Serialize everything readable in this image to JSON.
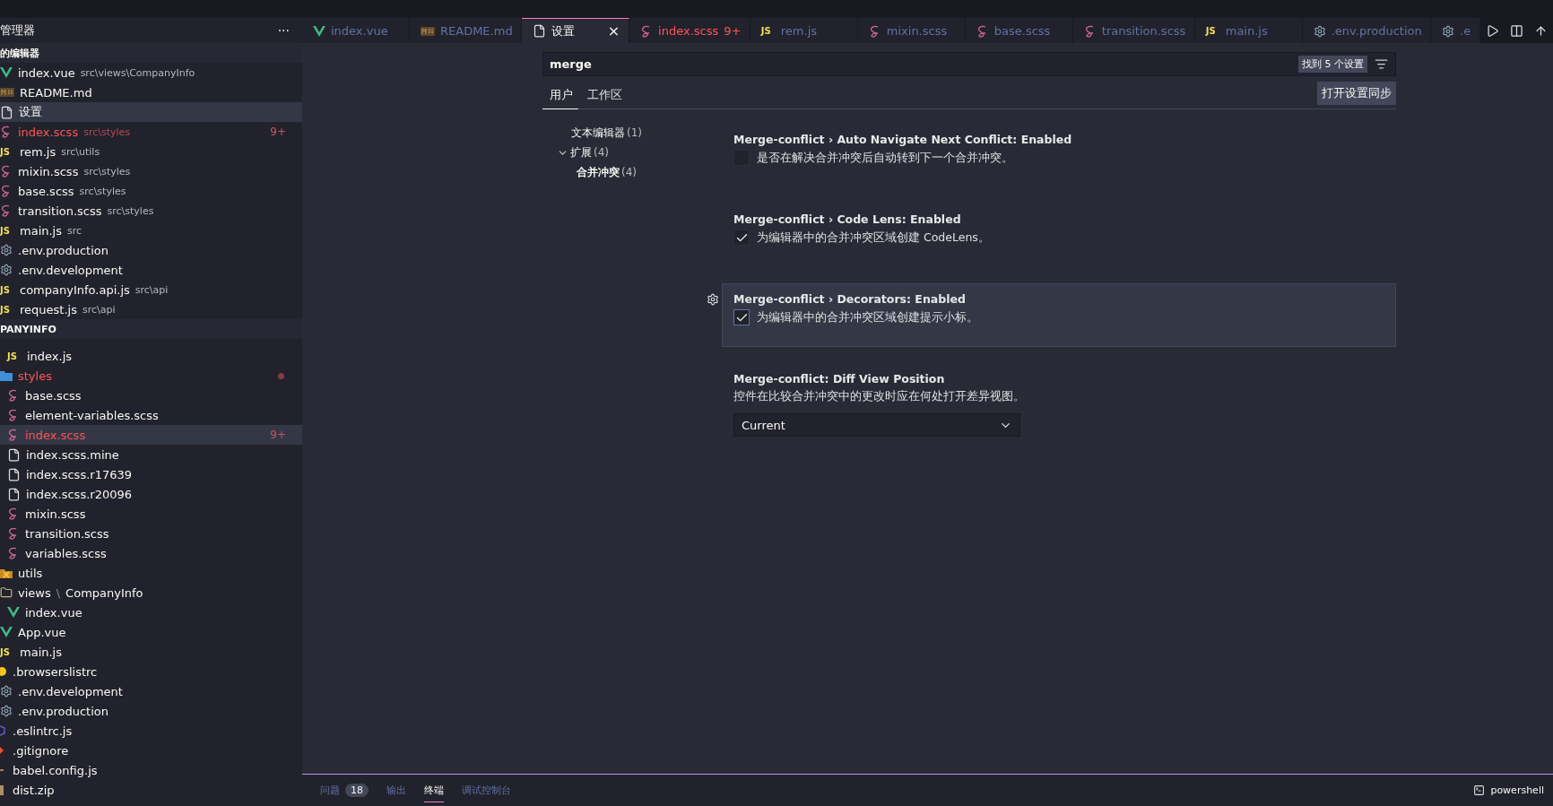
{
  "sidebar": {
    "title": "管理器",
    "more": "···",
    "open_editors": {
      "title": "的编辑器",
      "items": [
        {
          "kind": "vue",
          "name": "index.vue",
          "path": "src\\views\\CompanyInfo",
          "error": false,
          "selected": false
        },
        {
          "kind": "md",
          "name": "README.md",
          "error": false,
          "selected": false
        },
        {
          "kind": "file",
          "name": "设置",
          "error": false,
          "selected": true
        },
        {
          "kind": "sass",
          "name": "index.scss",
          "path": "src\\styles",
          "badge": "9+",
          "error": true,
          "selected": false
        },
        {
          "kind": "js",
          "glyph": "JS",
          "name": "rem.js",
          "path": "src\\utils",
          "error": false,
          "selected": false
        },
        {
          "kind": "sass",
          "name": "mixin.scss",
          "path": "src\\styles",
          "error": false,
          "selected": false
        },
        {
          "kind": "sass",
          "name": "base.scss",
          "path": "src\\styles",
          "error": false,
          "selected": false
        },
        {
          "kind": "sass",
          "name": "transition.scss",
          "path": "src\\styles",
          "error": false,
          "selected": false
        },
        {
          "kind": "js",
          "glyph": "JS",
          "name": "main.js",
          "path": "src",
          "error": false,
          "selected": false
        },
        {
          "kind": "gear",
          "name": ".env.production",
          "error": false,
          "selected": false
        },
        {
          "kind": "gear",
          "name": ".env.development",
          "error": false,
          "selected": false
        },
        {
          "kind": "js",
          "glyph": "JS",
          "name": "companyInfo.api.js",
          "path": "src\\api",
          "error": false,
          "selected": false
        },
        {
          "kind": "js",
          "glyph": "JS",
          "name": "request.js",
          "path": "src\\api",
          "error": false,
          "selected": false
        }
      ]
    },
    "project": {
      "title": "PANYINFO",
      "tree": [
        {
          "kind": "hidden",
          "children": [
            {
              "kind": "hidden",
              "children": [
                {
                  "kind": "js",
                  "glyph": "JS",
                  "name": "index.js",
                  "error": false,
                  "selected": false
                }
              ]
            },
            {
              "kind": "styles-folder",
              "name": "styles",
              "error": true,
              "dot": true,
              "selected": false,
              "children": [
                {
                  "kind": "sass",
                  "name": "base.scss",
                  "error": false,
                  "selected": false
                },
                {
                  "kind": "sass",
                  "name": "element-variables.scss",
                  "error": false,
                  "selected": false
                },
                {
                  "kind": "sass",
                  "name": "index.scss",
                  "badge": "9+",
                  "error": true,
                  "selected": true
                },
                {
                  "kind": "file",
                  "name": "index.scss.mine",
                  "error": false,
                  "selected": false
                },
                {
                  "kind": "file",
                  "name": "index.scss.r17639",
                  "error": false,
                  "selected": false
                },
                {
                  "kind": "file",
                  "name": "index.scss.r20096",
                  "error": false,
                  "selected": false
                },
                {
                  "kind": "sass",
                  "name": "mixin.scss",
                  "error": false,
                  "selected": false
                },
                {
                  "kind": "sass",
                  "name": "transition.scss",
                  "error": false,
                  "selected": false
                },
                {
                  "kind": "sass",
                  "name": "variables.scss",
                  "error": false,
                  "selected": false
                }
              ]
            },
            {
              "kind": "utils-folder",
              "name": "utils",
              "error": false,
              "selected": false
            },
            {
              "kind": "folder",
              "name": "views",
              "name2": "CompanyInfo",
              "sep": "\\",
              "error": false,
              "selected": false,
              "children": [
                {
                  "kind": "vue",
                  "name": "index.vue",
                  "error": false,
                  "selected": false
                }
              ]
            },
            {
              "kind": "vue",
              "name": "App.vue",
              "error": false,
              "selected": false
            },
            {
              "kind": "js",
              "glyph": "JS",
              "name": "main.js",
              "error": false,
              "selected": false
            }
          ]
        },
        {
          "kind": "browserslist",
          "name": ".browserslistrc",
          "error": false,
          "selected": false
        },
        {
          "kind": "gear",
          "name": ".env.development",
          "error": false,
          "selected": false
        },
        {
          "kind": "gear",
          "name": ".env.production",
          "error": false,
          "selected": false
        },
        {
          "kind": "eslint",
          "name": ".eslintrc.js",
          "error": false,
          "selected": false
        },
        {
          "kind": "git",
          "name": ".gitignore",
          "error": false,
          "selected": false
        },
        {
          "kind": "babel",
          "name": "babel.config.js",
          "error": false,
          "selected": false
        },
        {
          "kind": "zip",
          "name": "dist.zip",
          "error": false,
          "selected": false
        }
      ]
    }
  },
  "tabs": [
    {
      "kind": "vue",
      "label": "index.vue",
      "selected": false,
      "error": false
    },
    {
      "kind": "md",
      "label": "README.md",
      "selected": false,
      "error": false
    },
    {
      "kind": "file",
      "label": "设置",
      "selected": true,
      "error": false,
      "close": "×"
    },
    {
      "kind": "sass",
      "label": "index.scss",
      "badge": "9+",
      "selected": false,
      "error": true
    },
    {
      "kind": "js",
      "glyph": "JS",
      "label": "rem.js",
      "selected": false,
      "error": false
    },
    {
      "kind": "sass",
      "label": "mixin.scss",
      "selected": false,
      "error": false
    },
    {
      "kind": "sass",
      "label": "base.scss",
      "selected": false,
      "error": false
    },
    {
      "kind": "sass",
      "label": "transition.scss",
      "selected": false,
      "error": false
    },
    {
      "kind": "js",
      "glyph": "JS",
      "label": "main.js",
      "selected": false,
      "error": false
    },
    {
      "kind": "gear",
      "label": ".env.production",
      "selected": false,
      "error": false
    },
    {
      "kind": "gear",
      "label": ".e",
      "selected": false,
      "error": false
    }
  ],
  "settings": {
    "search": {
      "value": "merge",
      "result": "找到 5 个设置"
    },
    "scopes": [
      {
        "label": "用户",
        "selected": true
      },
      {
        "label": "工作区",
        "selected": false
      }
    ],
    "sync_button": "打开设置同步",
    "toc": [
      {
        "label": "文本编辑器",
        "count": "(1)",
        "bold": false
      },
      {
        "label": "扩展",
        "count": "(4)",
        "bold": false,
        "expanded": true,
        "children": [
          {
            "label": "合并冲突",
            "count": "(4)",
            "bold": true
          }
        ]
      }
    ],
    "items": [
      {
        "kind": "checkbox",
        "title": "Merge-conflict › Auto Navigate Next Conflict: Enabled",
        "description": "是否在解决合并冲突后自动转到下一个合并冲突。",
        "checked": false,
        "focused": false
      },
      {
        "kind": "checkbox",
        "title": "Merge-conflict › Code Lens: Enabled",
        "description": "为编辑器中的合并冲突区域创建 CodeLens。",
        "checked": true,
        "focused": false
      },
      {
        "kind": "checkbox",
        "title": "Merge-conflict › Decorators: Enabled",
        "description": "为编辑器中的合并冲突区域创建提示小标。",
        "checked": true,
        "focused": true
      },
      {
        "kind": "dropdown",
        "title": "Merge-conflict: Diff View Position",
        "description": "控件在比较合并冲突中的更改时应在何处打开差异视图。",
        "value": "Current",
        "focused": false
      }
    ]
  },
  "panel": {
    "tabs": [
      {
        "label": "问题",
        "badge": "18",
        "selected": false
      },
      {
        "label": "输出",
        "selected": false
      },
      {
        "label": "终端",
        "selected": true
      },
      {
        "label": "调试控制台",
        "selected": false
      }
    ],
    "terminal": "powershell"
  }
}
